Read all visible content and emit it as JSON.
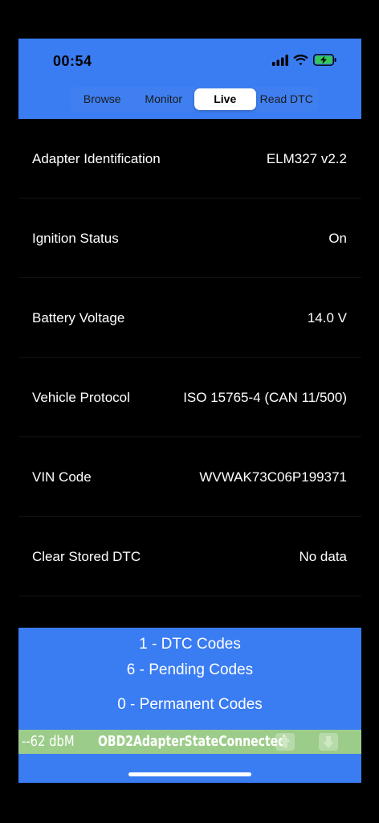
{
  "status_bar": {
    "time": "00:54"
  },
  "segments": [
    {
      "label": "Browse",
      "active": false
    },
    {
      "label": "Monitor",
      "active": false
    },
    {
      "label": "Live",
      "active": true
    },
    {
      "label": "Read DTC",
      "active": false
    }
  ],
  "rows": [
    {
      "label": "Adapter Identification",
      "value": "ELM327 v2.2"
    },
    {
      "label": "Ignition Status",
      "value": "On"
    },
    {
      "label": "Battery Voltage",
      "value": "14.0 V"
    },
    {
      "label": "Vehicle Protocol",
      "value": "ISO 15765-4 (CAN 11/500)"
    },
    {
      "label": "VIN Code",
      "value": "WVWAK73C06P199371"
    },
    {
      "label": "Clear Stored DTC",
      "value": "No data"
    }
  ],
  "codes": {
    "dtc": "1 - DTC Codes",
    "pending": "6 - Pending Codes",
    "permanent": "0 - Permanent Codes"
  },
  "adapter_bar": {
    "signal": "--62 dbM",
    "state": "OBD2AdapterStateConnected"
  },
  "colors": {
    "accent": "#3a7cf2",
    "adapter_bar": "#9ccc8a",
    "background": "#000000"
  },
  "icons": [
    "cellular-signal-icon",
    "wifi-icon",
    "battery-charging-icon",
    "arrow-up-icon",
    "arrow-down-icon"
  ]
}
